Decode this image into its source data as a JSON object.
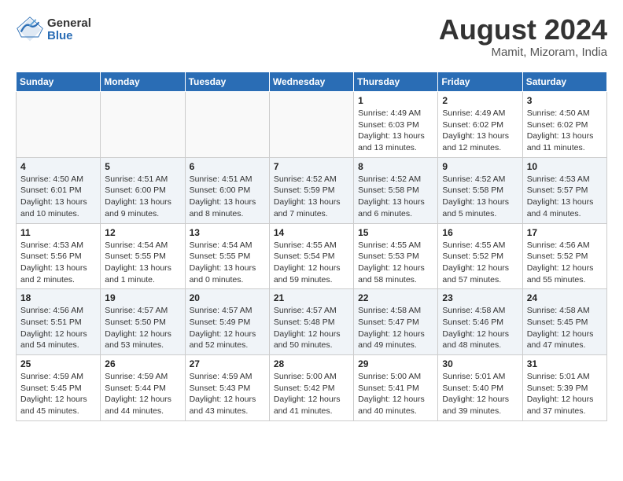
{
  "header": {
    "logo_general": "General",
    "logo_blue": "Blue",
    "month_title": "August 2024",
    "subtitle": "Mamit, Mizoram, India"
  },
  "days_of_week": [
    "Sunday",
    "Monday",
    "Tuesday",
    "Wednesday",
    "Thursday",
    "Friday",
    "Saturday"
  ],
  "weeks": [
    {
      "shaded": false,
      "days": [
        {
          "number": "",
          "info": "",
          "empty": true
        },
        {
          "number": "",
          "info": "",
          "empty": true
        },
        {
          "number": "",
          "info": "",
          "empty": true
        },
        {
          "number": "",
          "info": "",
          "empty": true
        },
        {
          "number": "1",
          "info": "Sunrise: 4:49 AM\nSunset: 6:03 PM\nDaylight: 13 hours\nand 13 minutes.",
          "empty": false
        },
        {
          "number": "2",
          "info": "Sunrise: 4:49 AM\nSunset: 6:02 PM\nDaylight: 13 hours\nand 12 minutes.",
          "empty": false
        },
        {
          "number": "3",
          "info": "Sunrise: 4:50 AM\nSunset: 6:02 PM\nDaylight: 13 hours\nand 11 minutes.",
          "empty": false
        }
      ]
    },
    {
      "shaded": true,
      "days": [
        {
          "number": "4",
          "info": "Sunrise: 4:50 AM\nSunset: 6:01 PM\nDaylight: 13 hours\nand 10 minutes.",
          "empty": false
        },
        {
          "number": "5",
          "info": "Sunrise: 4:51 AM\nSunset: 6:00 PM\nDaylight: 13 hours\nand 9 minutes.",
          "empty": false
        },
        {
          "number": "6",
          "info": "Sunrise: 4:51 AM\nSunset: 6:00 PM\nDaylight: 13 hours\nand 8 minutes.",
          "empty": false
        },
        {
          "number": "7",
          "info": "Sunrise: 4:52 AM\nSunset: 5:59 PM\nDaylight: 13 hours\nand 7 minutes.",
          "empty": false
        },
        {
          "number": "8",
          "info": "Sunrise: 4:52 AM\nSunset: 5:58 PM\nDaylight: 13 hours\nand 6 minutes.",
          "empty": false
        },
        {
          "number": "9",
          "info": "Sunrise: 4:52 AM\nSunset: 5:58 PM\nDaylight: 13 hours\nand 5 minutes.",
          "empty": false
        },
        {
          "number": "10",
          "info": "Sunrise: 4:53 AM\nSunset: 5:57 PM\nDaylight: 13 hours\nand 4 minutes.",
          "empty": false
        }
      ]
    },
    {
      "shaded": false,
      "days": [
        {
          "number": "11",
          "info": "Sunrise: 4:53 AM\nSunset: 5:56 PM\nDaylight: 13 hours\nand 2 minutes.",
          "empty": false
        },
        {
          "number": "12",
          "info": "Sunrise: 4:54 AM\nSunset: 5:55 PM\nDaylight: 13 hours\nand 1 minute.",
          "empty": false
        },
        {
          "number": "13",
          "info": "Sunrise: 4:54 AM\nSunset: 5:55 PM\nDaylight: 13 hours\nand 0 minutes.",
          "empty": false
        },
        {
          "number": "14",
          "info": "Sunrise: 4:55 AM\nSunset: 5:54 PM\nDaylight: 12 hours\nand 59 minutes.",
          "empty": false
        },
        {
          "number": "15",
          "info": "Sunrise: 4:55 AM\nSunset: 5:53 PM\nDaylight: 12 hours\nand 58 minutes.",
          "empty": false
        },
        {
          "number": "16",
          "info": "Sunrise: 4:55 AM\nSunset: 5:52 PM\nDaylight: 12 hours\nand 57 minutes.",
          "empty": false
        },
        {
          "number": "17",
          "info": "Sunrise: 4:56 AM\nSunset: 5:52 PM\nDaylight: 12 hours\nand 55 minutes.",
          "empty": false
        }
      ]
    },
    {
      "shaded": true,
      "days": [
        {
          "number": "18",
          "info": "Sunrise: 4:56 AM\nSunset: 5:51 PM\nDaylight: 12 hours\nand 54 minutes.",
          "empty": false
        },
        {
          "number": "19",
          "info": "Sunrise: 4:57 AM\nSunset: 5:50 PM\nDaylight: 12 hours\nand 53 minutes.",
          "empty": false
        },
        {
          "number": "20",
          "info": "Sunrise: 4:57 AM\nSunset: 5:49 PM\nDaylight: 12 hours\nand 52 minutes.",
          "empty": false
        },
        {
          "number": "21",
          "info": "Sunrise: 4:57 AM\nSunset: 5:48 PM\nDaylight: 12 hours\nand 50 minutes.",
          "empty": false
        },
        {
          "number": "22",
          "info": "Sunrise: 4:58 AM\nSunset: 5:47 PM\nDaylight: 12 hours\nand 49 minutes.",
          "empty": false
        },
        {
          "number": "23",
          "info": "Sunrise: 4:58 AM\nSunset: 5:46 PM\nDaylight: 12 hours\nand 48 minutes.",
          "empty": false
        },
        {
          "number": "24",
          "info": "Sunrise: 4:58 AM\nSunset: 5:45 PM\nDaylight: 12 hours\nand 47 minutes.",
          "empty": false
        }
      ]
    },
    {
      "shaded": false,
      "days": [
        {
          "number": "25",
          "info": "Sunrise: 4:59 AM\nSunset: 5:45 PM\nDaylight: 12 hours\nand 45 minutes.",
          "empty": false
        },
        {
          "number": "26",
          "info": "Sunrise: 4:59 AM\nSunset: 5:44 PM\nDaylight: 12 hours\nand 44 minutes.",
          "empty": false
        },
        {
          "number": "27",
          "info": "Sunrise: 4:59 AM\nSunset: 5:43 PM\nDaylight: 12 hours\nand 43 minutes.",
          "empty": false
        },
        {
          "number": "28",
          "info": "Sunrise: 5:00 AM\nSunset: 5:42 PM\nDaylight: 12 hours\nand 41 minutes.",
          "empty": false
        },
        {
          "number": "29",
          "info": "Sunrise: 5:00 AM\nSunset: 5:41 PM\nDaylight: 12 hours\nand 40 minutes.",
          "empty": false
        },
        {
          "number": "30",
          "info": "Sunrise: 5:01 AM\nSunset: 5:40 PM\nDaylight: 12 hours\nand 39 minutes.",
          "empty": false
        },
        {
          "number": "31",
          "info": "Sunrise: 5:01 AM\nSunset: 5:39 PM\nDaylight: 12 hours\nand 37 minutes.",
          "empty": false
        }
      ]
    }
  ]
}
